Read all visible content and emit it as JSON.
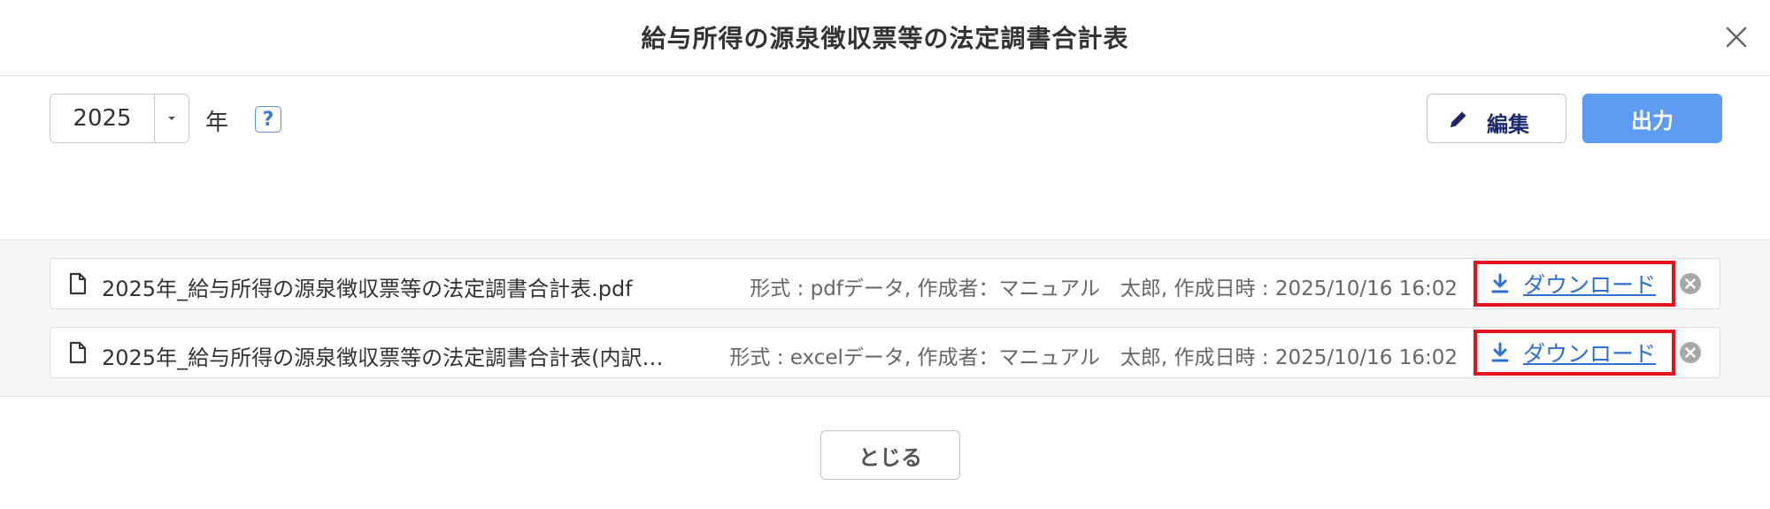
{
  "dialog": {
    "title": "給与所得の源泉徴収票等の法定調書合計表",
    "close_icon": "close-icon"
  },
  "toolbar": {
    "year_value": "2025",
    "year_label": "年",
    "help_label": "?",
    "edit_label": "編集",
    "export_label": "出力"
  },
  "files": [
    {
      "name": "2025年_給与所得の源泉徴収票等の法定調書合計表.pdf",
      "meta": "形式 : pdfデータ, 作成者：マニュアル　太郎, 作成日時 : 2025/10/16 16:02",
      "download_label": "ダウンロード"
    },
    {
      "name": "2025年_給与所得の源泉徴収票等の法定調書合計表(内訳…",
      "meta": "形式 : excelデータ, 作成者：マニュアル　太郎, 作成日時 : 2025/10/16 16:02",
      "download_label": "ダウンロード"
    }
  ],
  "footer": {
    "close_label": "とじる"
  },
  "colors": {
    "primary": "#5e9cf1",
    "link": "#2f6fd0",
    "highlight": "#e5131b"
  }
}
